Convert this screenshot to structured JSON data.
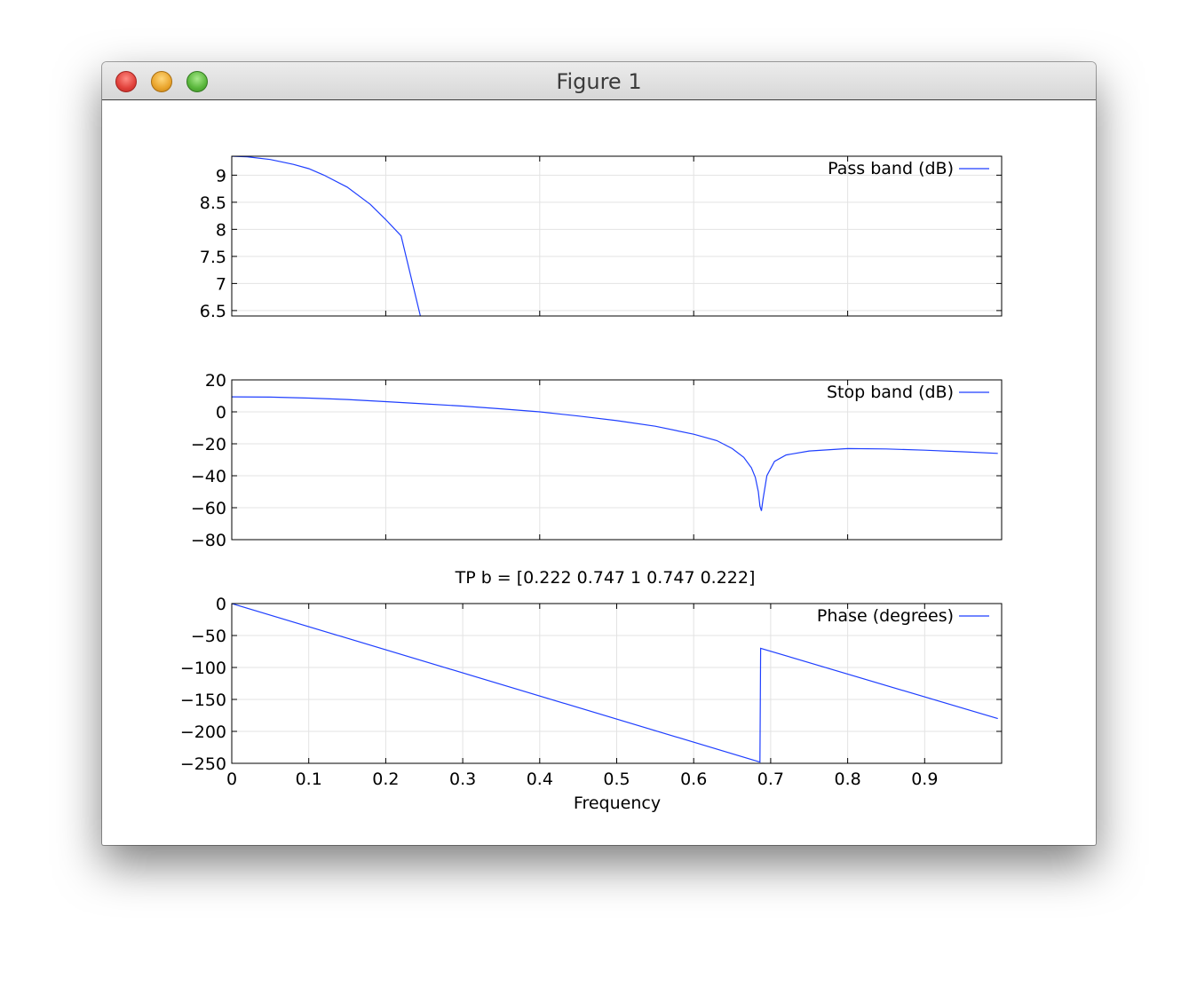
{
  "window": {
    "title": "Figure 1"
  },
  "chart_data": [
    {
      "type": "line",
      "legend": "Pass band (dB)",
      "legend_position": "top-right",
      "xlim": [
        0,
        1
      ],
      "ylim": [
        6.4,
        9.35
      ],
      "grid": true,
      "x_ticks": [],
      "y_ticks": [
        "9",
        "8.5",
        "8",
        "7.5",
        "7",
        "6.5"
      ],
      "series": [
        {
          "name": "Pass band (dB)",
          "color": "#1f3fff",
          "x": [
            0,
            0.02,
            0.05,
            0.08,
            0.1,
            0.12,
            0.15,
            0.18,
            0.2,
            0.22,
            0.245
          ],
          "y": [
            9.35,
            9.34,
            9.29,
            9.2,
            9.12,
            9.0,
            8.78,
            8.46,
            8.18,
            7.88,
            6.4
          ]
        }
      ]
    },
    {
      "type": "line",
      "legend": "Stop band (dB)",
      "legend_position": "top-right",
      "xlim": [
        0,
        1
      ],
      "ylim": [
        -80,
        20
      ],
      "grid": true,
      "x_ticks": [],
      "y_ticks": [
        "20",
        "0",
        "−20",
        "−40",
        "−60",
        "−80"
      ],
      "series": [
        {
          "name": "Stop band (dB)",
          "color": "#1f3fff",
          "x": [
            0,
            0.05,
            0.1,
            0.15,
            0.2,
            0.25,
            0.3,
            0.35,
            0.4,
            0.45,
            0.5,
            0.55,
            0.6,
            0.63,
            0.65,
            0.665,
            0.675,
            0.68,
            0.684,
            0.686,
            0.688,
            0.69,
            0.695,
            0.705,
            0.72,
            0.75,
            0.8,
            0.85,
            0.9,
            0.95,
            0.995
          ],
          "y": [
            9.4,
            9.2,
            8.6,
            7.7,
            6.4,
            5.0,
            3.6,
            1.9,
            0.0,
            -2.6,
            -5.5,
            -9.0,
            -14.0,
            -18.0,
            -23.0,
            -28.5,
            -35.0,
            -41.0,
            -50.0,
            -59.0,
            -62.0,
            -55.0,
            -40.0,
            -31.0,
            -27.0,
            -24.5,
            -23.0,
            -23.2,
            -24.0,
            -25.0,
            -26.0
          ]
        }
      ]
    },
    {
      "type": "line",
      "title": "TP b = [0.222 0.747 1 0.747 0.222]",
      "xlabel": "Frequency",
      "legend": "Phase (degrees)",
      "legend_position": "top-right",
      "xlim": [
        0,
        1
      ],
      "ylim": [
        -250,
        0
      ],
      "grid": true,
      "x_ticks": [
        "0",
        "0.1",
        "0.2",
        "0.3",
        "0.4",
        "0.5",
        "0.6",
        "0.7",
        "0.8",
        "0.9"
      ],
      "y_ticks": [
        "0",
        "−50",
        "−100",
        "−150",
        "−200",
        "−250"
      ],
      "series": [
        {
          "name": "Phase (degrees)",
          "color": "#1f3fff",
          "x": [
            0,
            0.686,
            0.687,
            0.995
          ],
          "y": [
            0,
            -248,
            -70,
            -180
          ]
        }
      ]
    }
  ]
}
